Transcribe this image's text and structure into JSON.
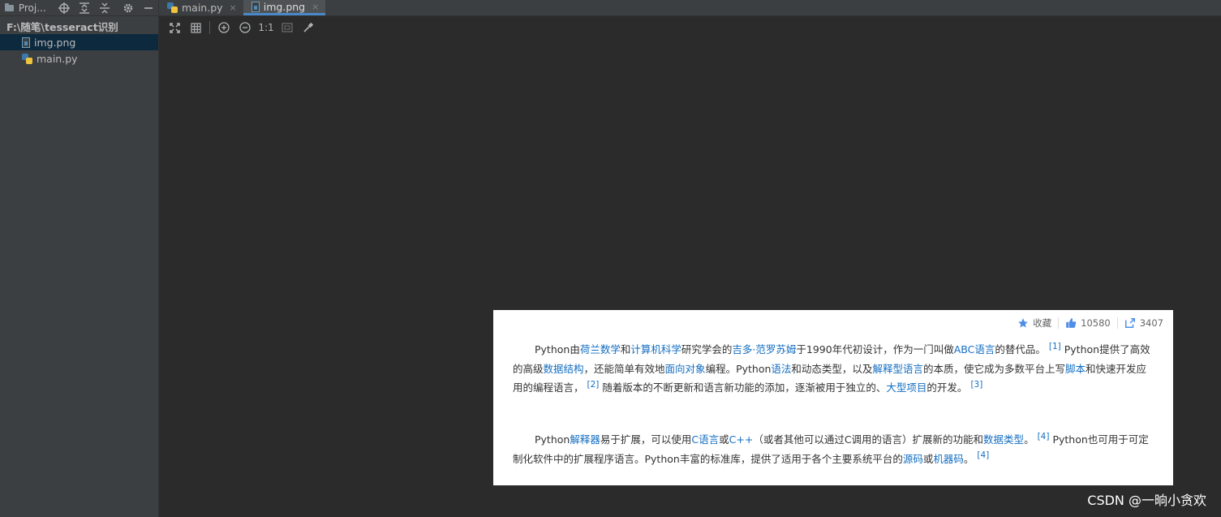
{
  "sidebar": {
    "title": "Proj...",
    "tree": [
      {
        "label": "F:\\随笔\\tesseract识别"
      },
      {
        "label": "img.png"
      },
      {
        "label": "main.py"
      }
    ]
  },
  "tabs": [
    {
      "label": "main.py",
      "close": "×"
    },
    {
      "label": "img.png",
      "close": "×"
    }
  ],
  "viewer_toolbar": {
    "actual_size": "1:1"
  },
  "image": {
    "stats": {
      "favorite": "收藏",
      "likes": "10580",
      "shares": "3407"
    },
    "para1": {
      "t1": "Python由",
      "l1": "荷兰数学",
      "t2": "和",
      "l2": "计算机科学",
      "t3": "研究学会的",
      "l3": "吉多·范罗苏姆",
      "t4": "于1990年代初设计，作为一门叫做",
      "l4": "ABC语言",
      "t5": "的替代品。",
      "r1": "[1]",
      "t6": "Python提供了高效的高级",
      "l5": "数据结构",
      "t7": "，还能简单有效地",
      "l6": "面向对象",
      "t8": "编程。Python",
      "l7": "语法",
      "t9": "和动态类型，以及",
      "l8": "解释型语言",
      "t10": "的本质，使它成为多数平台上写",
      "l9": "脚本",
      "t11": "和快速开发应用的编程语言，",
      "r2": "[2]",
      "t12": "随着版本的不断更新和语言新功能的添加，逐渐被用于独立的、",
      "l10": "大型项目",
      "t13": "的开发。",
      "r3": "[3]"
    },
    "para2": {
      "t1": "Python",
      "l1": "解释器",
      "t2": "易于扩展，可以使用",
      "l2": "C语言",
      "t3": "或",
      "l3": "C++",
      "t4": "（或者其他可以通过C调用的语言）扩展新的功能和",
      "l4": "数据类型",
      "t5": "。",
      "r1": "[4]",
      "t6": "Python也可用于可定制化软件中的扩展程序语言。Python丰富的标准库，提供了适用于各个主要系统平台的",
      "l5": "源码",
      "t7": "或",
      "l6": "机器码",
      "t8": "。",
      "r2": "[4]"
    }
  },
  "watermark": "CSDN @一晌小贪欢",
  "colors": {
    "accent": "#4a88c7",
    "link": "#136ec2",
    "bg": "#2b2b2b",
    "panel": "#3c3f41"
  }
}
